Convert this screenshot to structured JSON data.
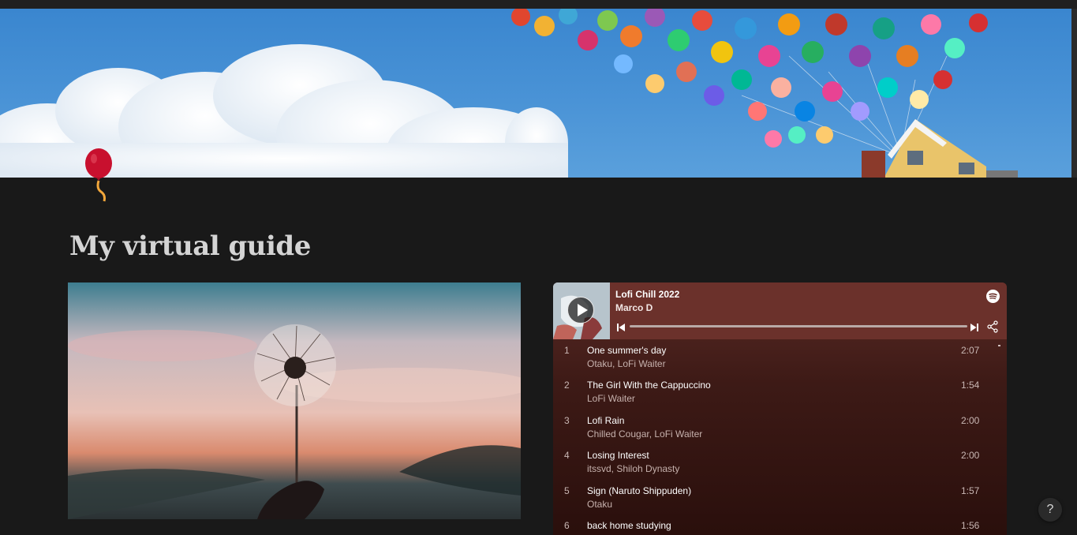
{
  "page": {
    "title": "My virtual guide",
    "cover_description_icon": "balloon-icon"
  },
  "player": {
    "playlist_title": "Lofi Chill 2022",
    "playlist_author": "Marco D",
    "brand_icon": "spotify-icon",
    "accent_color": "#6b312b",
    "tracks": [
      {
        "num": "1",
        "name": "One summer's day",
        "artists": "Otaku, LoFi Waiter",
        "duration": "2:07"
      },
      {
        "num": "2",
        "name": "The Girl With the Cappuccino",
        "artists": "LoFi Waiter",
        "duration": "1:54"
      },
      {
        "num": "3",
        "name": "Lofi Rain",
        "artists": "Chilled Cougar, LoFi Waiter",
        "duration": "2:00"
      },
      {
        "num": "4",
        "name": "Losing Interest",
        "artists": "itssvd, Shiloh Dynasty",
        "duration": "2:00"
      },
      {
        "num": "5",
        "name": "Sign (Naruto Shippuden)",
        "artists": "Otaku",
        "duration": "1:57"
      },
      {
        "num": "6",
        "name": "back home studying",
        "artists": "",
        "duration": "1:56"
      }
    ]
  },
  "help": {
    "label": "?"
  }
}
